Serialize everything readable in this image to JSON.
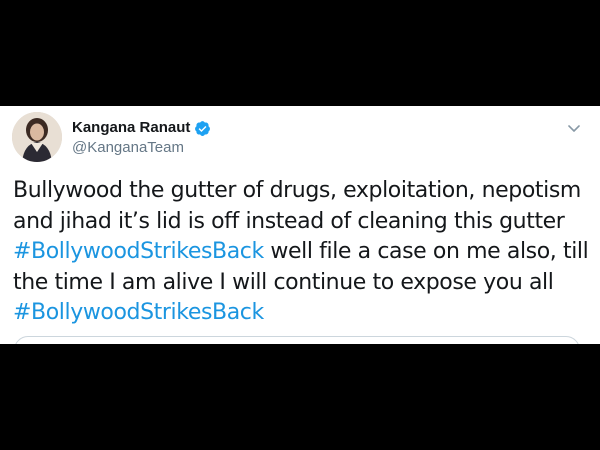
{
  "tweet": {
    "author": {
      "display_name": "Kangana Ranaut",
      "handle": "@KanganaTeam",
      "verified": true
    },
    "text_lines": {
      "l1": "Bullywood the gutter of drugs, exploitation, nepotism",
      "l2": "and jihad it’s lid is off instead of cleaning this gutter",
      "l3_hashtag": "#BollywoodStrikesBack",
      "l3_rest": " well file a case on me also, till",
      "l4": "the time I am alive I will continue to expose you all",
      "l5_hashtag": "#BollywoodStrikesBack"
    }
  },
  "icons": {
    "verified": "verified-badge-icon",
    "menu": "chevron-down-icon",
    "avatar": "avatar"
  },
  "colors": {
    "background": "#000000",
    "card": "#ffffff",
    "text": "#14171a",
    "secondary_text": "#657786",
    "hashtag": "#1b95e0",
    "verified": "#1da1f2"
  }
}
